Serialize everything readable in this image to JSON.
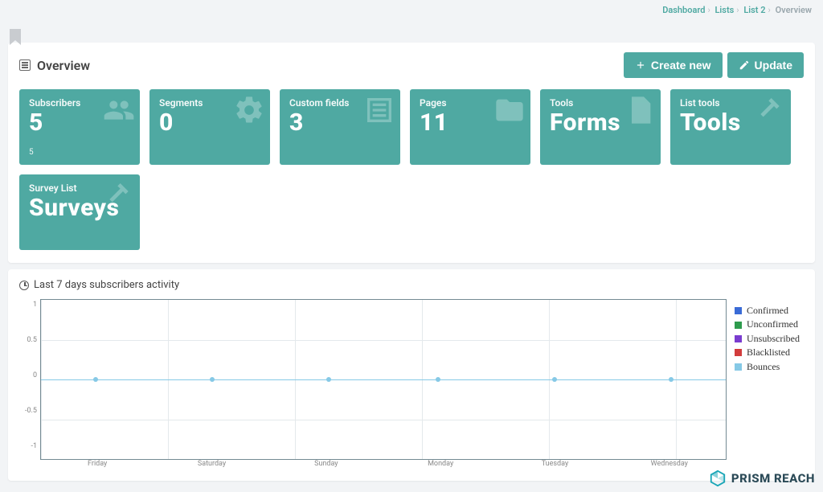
{
  "breadcrumb": {
    "items": [
      "Dashboard",
      "Lists",
      "List 2"
    ],
    "current": "Overview"
  },
  "page_title": "Overview",
  "actions": {
    "create": "Create new",
    "update": "Update"
  },
  "tiles": [
    {
      "label": "Subscribers",
      "value": "5",
      "sub": "5",
      "icon": "users"
    },
    {
      "label": "Segments",
      "value": "0",
      "sub": "",
      "icon": "gear"
    },
    {
      "label": "Custom fields",
      "value": "3",
      "sub": "",
      "icon": "list"
    },
    {
      "label": "Pages",
      "value": "11",
      "sub": "",
      "icon": "folder"
    },
    {
      "label": "Tools",
      "value": "Forms",
      "sub": "",
      "icon": "page"
    },
    {
      "label": "List tools",
      "value": "Tools",
      "sub": "",
      "icon": "hammer"
    },
    {
      "label": "Survey List",
      "value": "Surveys",
      "sub": "",
      "icon": "hammer"
    }
  ],
  "chart_panel_title": "Last 7 days subscribers activity",
  "chart_data": {
    "type": "line",
    "categories": [
      "Friday",
      "Saturday",
      "Sunday",
      "Monday",
      "Tuesday",
      "Wednesday"
    ],
    "ylim": [
      -1.0,
      1.0
    ],
    "yticks": [
      1.0,
      0.5,
      0.0,
      -0.5,
      -1.0
    ],
    "series": [
      {
        "name": "Confirmed",
        "color": "#3a6bd6",
        "values": [
          0,
          0,
          0,
          0,
          0,
          0
        ]
      },
      {
        "name": "Unconfirmed",
        "color": "#2e9b4d",
        "values": [
          0,
          0,
          0,
          0,
          0,
          0
        ]
      },
      {
        "name": "Unsubscribed",
        "color": "#7a3ccf",
        "values": [
          0,
          0,
          0,
          0,
          0,
          0
        ]
      },
      {
        "name": "Blacklisted",
        "color": "#d23c3c",
        "values": [
          0,
          0,
          0,
          0,
          0,
          0
        ]
      },
      {
        "name": "Bounces",
        "color": "#86c9e6",
        "values": [
          0,
          0,
          0,
          0,
          0,
          0
        ]
      }
    ]
  },
  "brand": "PRISM REACH"
}
